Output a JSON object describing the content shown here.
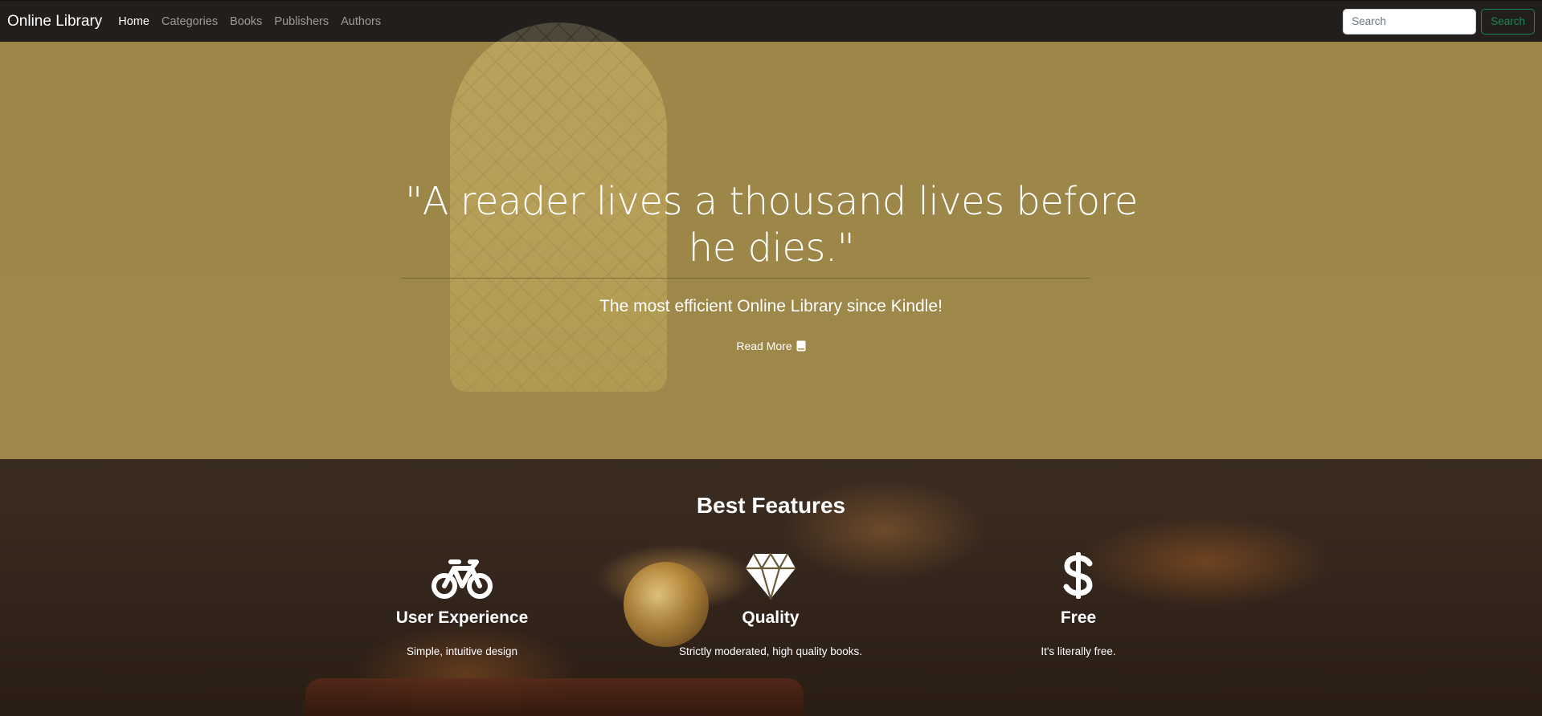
{
  "navbar": {
    "brand": "Online Library",
    "links": [
      {
        "label": "Home",
        "active": true
      },
      {
        "label": "Categories",
        "active": false
      },
      {
        "label": "Books",
        "active": false
      },
      {
        "label": "Publishers",
        "active": false
      },
      {
        "label": "Authors",
        "active": false
      }
    ],
    "search": {
      "placeholder": "Search",
      "value": "",
      "button_label": "Search"
    }
  },
  "hero": {
    "quote": "\"A reader lives a thousand lives before he dies.\"",
    "tagline": "The most efficient Online Library since Kindle!",
    "read_more_label": "Read More",
    "read_more_icon": "book-icon"
  },
  "features": {
    "title": "Best Features",
    "items": [
      {
        "icon": "bicycle-icon",
        "title": "User Experience",
        "description": "Simple, intuitive design"
      },
      {
        "icon": "gem-icon",
        "title": "Quality",
        "description": "Strictly moderated, high quality books."
      },
      {
        "icon": "dollar-icon",
        "title": "Free",
        "description": "It's literally free."
      }
    ]
  },
  "colors": {
    "hero_overlay": "#b59c52",
    "navbar_bg": "#1e1c1a",
    "search_button": "#198754",
    "text": "#ffffff"
  }
}
